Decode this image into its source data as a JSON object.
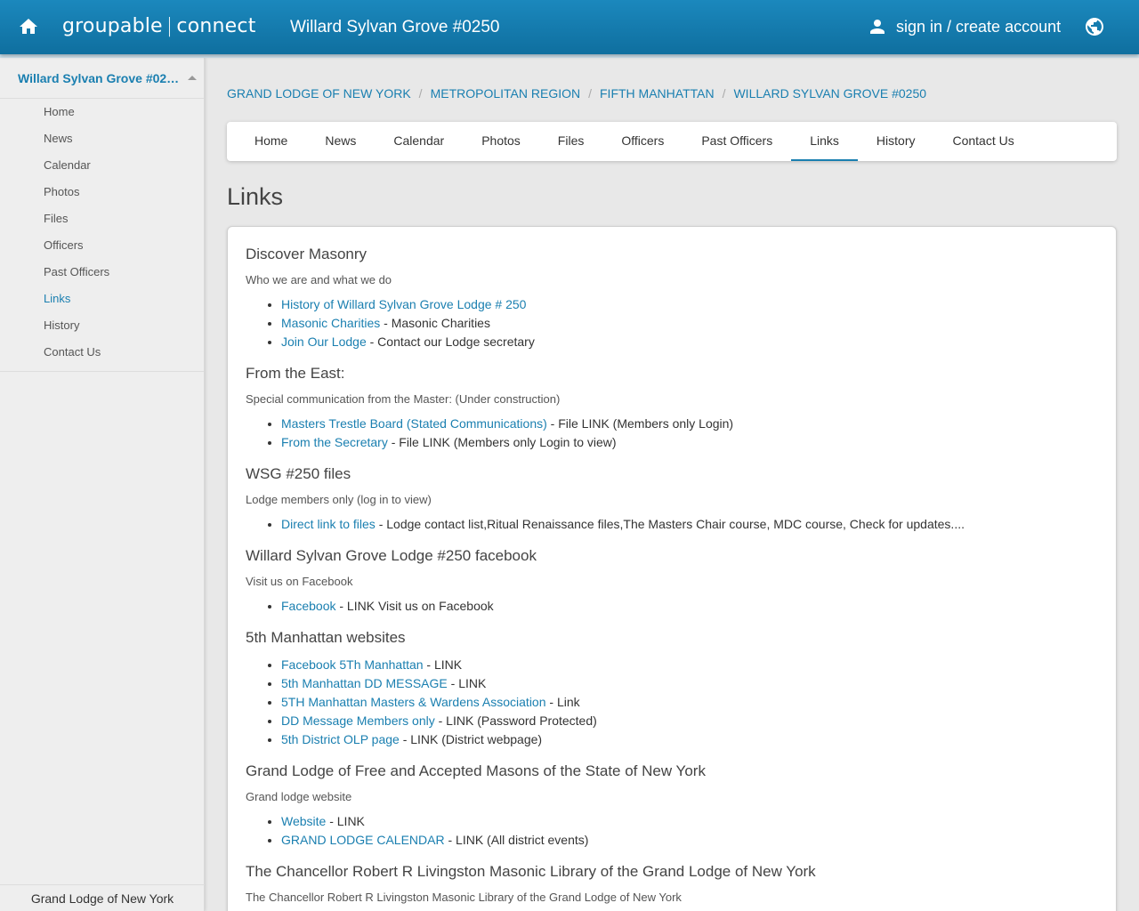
{
  "header": {
    "brand_left": "groupable",
    "brand_sep": "|",
    "brand_right": "connect",
    "site_title": "Willard Sylvan Grove #0250",
    "signin_label": "sign in / create account",
    "icons": [
      "home-icon",
      "person-icon",
      "globe-icon"
    ]
  },
  "sidebar": {
    "title": "Willard Sylvan Grove #02…",
    "items": [
      {
        "label": "Home"
      },
      {
        "label": "News"
      },
      {
        "label": "Calendar"
      },
      {
        "label": "Photos"
      },
      {
        "label": "Files"
      },
      {
        "label": "Officers"
      },
      {
        "label": "Past Officers"
      },
      {
        "label": "Links"
      },
      {
        "label": "History"
      },
      {
        "label": "Contact Us"
      }
    ],
    "active_label": "Links",
    "footer": "Grand Lodge of New York"
  },
  "breadcrumb": [
    "GRAND LODGE OF NEW YORK",
    "METROPOLITAN REGION",
    "FIFTH MANHATTAN",
    "WILLARD SYLVAN GROVE #0250"
  ],
  "breadcrumb_sep": "/",
  "tabs": [
    {
      "label": "Home"
    },
    {
      "label": "News"
    },
    {
      "label": "Calendar"
    },
    {
      "label": "Photos"
    },
    {
      "label": "Files"
    },
    {
      "label": "Officers"
    },
    {
      "label": "Past Officers"
    },
    {
      "label": "Links"
    },
    {
      "label": "History"
    },
    {
      "label": "Contact Us"
    }
  ],
  "active_tab": "Links",
  "page_title": "Links",
  "sections": [
    {
      "title": "Discover Masonry",
      "desc": "Who we are and what we do",
      "links": [
        {
          "link": "History of Willard Sylvan Grove Lodge # 250",
          "note": ""
        },
        {
          "link": "Masonic Charities",
          "note": " - Masonic Charities"
        },
        {
          "link": "Join Our Lodge",
          "note": " - Contact our Lodge secretary"
        }
      ]
    },
    {
      "title": "From the East:",
      "desc": "Special communication from the Master: (Under construction)",
      "links": [
        {
          "link": "Masters Trestle Board (Stated Communications)",
          "note": " - File LINK (Members only Login)"
        },
        {
          "link": "From the Secretary",
          "note": " - File LINK (Members only Login to view)"
        }
      ]
    },
    {
      "title": "WSG #250 files",
      "desc": "Lodge members only (log in to view)",
      "links": [
        {
          "link": "Direct link to files",
          "note": " - Lodge contact list,Ritual Renaissance files,The Masters Chair course, MDC course, Check for updates...."
        }
      ]
    },
    {
      "title": "Willard Sylvan Grove Lodge #250 facebook",
      "desc": "Visit us on Facebook",
      "links": [
        {
          "link": "Facebook",
          "note": " - LINK Visit us on Facebook"
        }
      ]
    },
    {
      "title": "5th Manhattan websites",
      "desc": "",
      "links": [
        {
          "link": "Facebook 5Th Manhattan",
          "note": " - LINK"
        },
        {
          "link": "5th Manhattan DD MESSAGE",
          "note": " - LINK"
        },
        {
          "link": "5TH Manhattan Masters & Wardens Association",
          "note": " - Link"
        },
        {
          "link": "DD Message Members only",
          "note": " - LINK (Password Protected)"
        },
        {
          "link": "5th District OLP page",
          "note": " - LINK (District webpage)"
        }
      ]
    },
    {
      "title": "Grand Lodge of Free and Accepted Masons of the State of New York",
      "desc": "Grand lodge website",
      "links": [
        {
          "link": "Website",
          "note": " - LINK"
        },
        {
          "link": "GRAND LODGE CALENDAR",
          "note": " - LINK (All district events)"
        }
      ]
    },
    {
      "title": "The Chancellor Robert R Livingston Masonic Library of the Grand Lodge of New York",
      "desc": "The Chancellor Robert R Livingston Masonic Library of the Grand Lodge of New York",
      "links": []
    }
  ]
}
